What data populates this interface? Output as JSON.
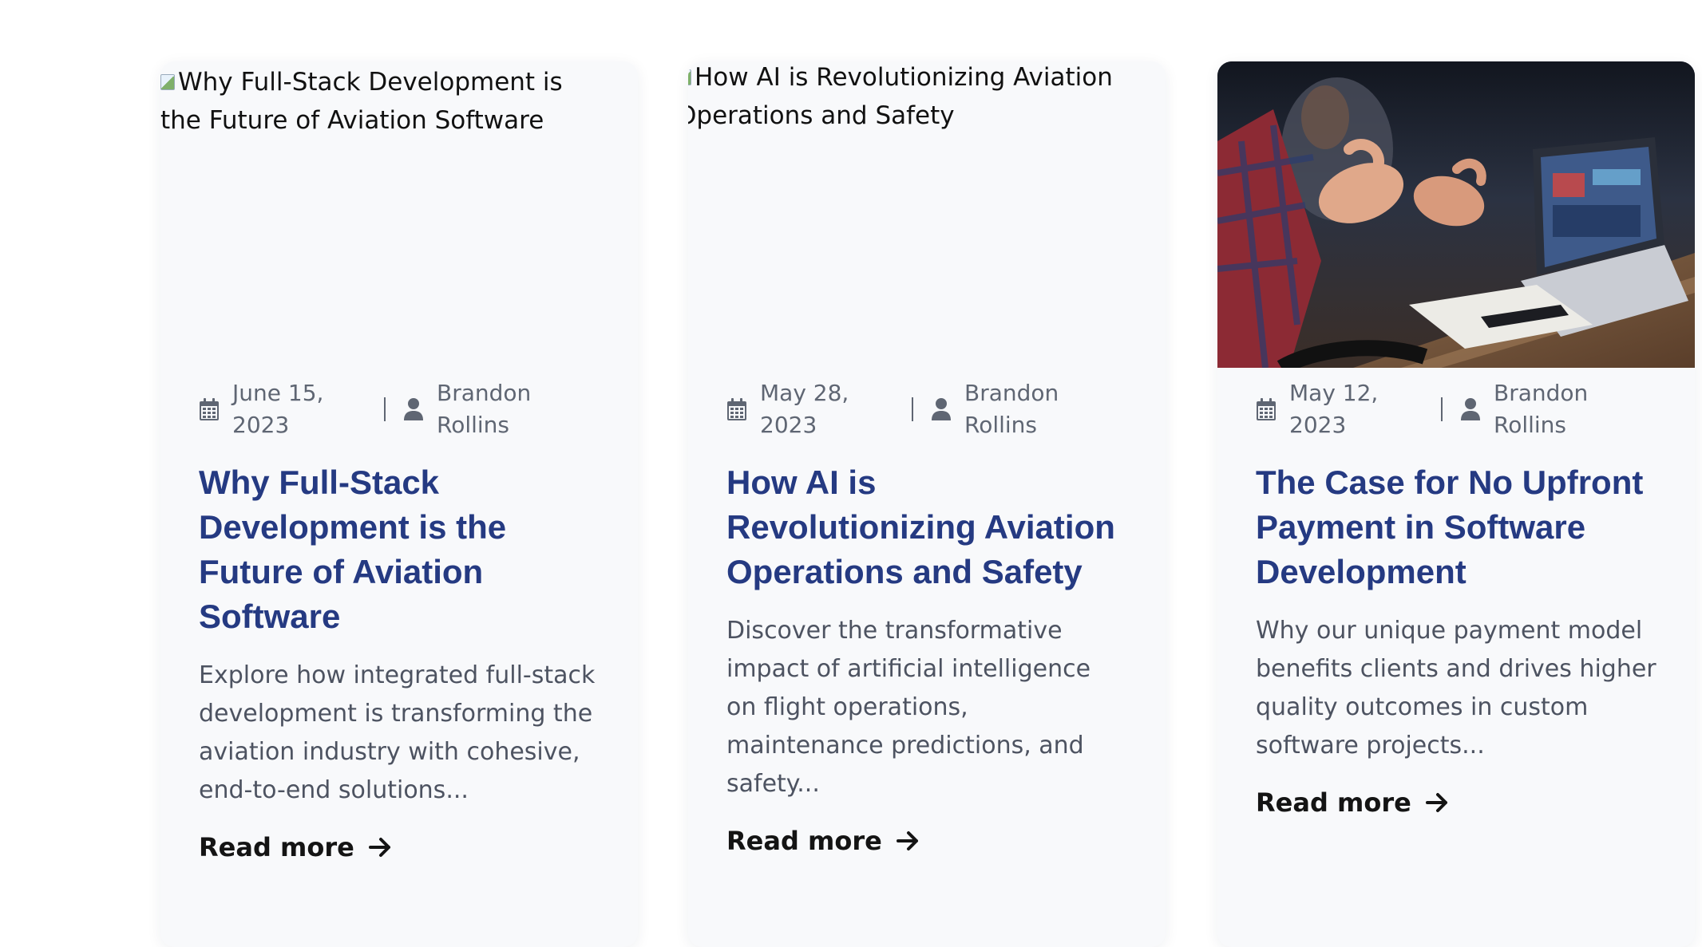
{
  "posts": [
    {
      "image_alt": "Why Full-Stack Development is the Future of Aviation Software",
      "date": "June 15, 2023",
      "author": "Brandon Rollins",
      "title": "Why Full-Stack Development is the Future of Aviation Software",
      "excerpt": "Explore how integrated full-stack development is transforming the aviation industry with cohesive, end-to-end solutions...",
      "read_more": "Read more"
    },
    {
      "image_alt": "How AI is Revolutionizing Aviation Operations and Safety",
      "date": "May 28, 2023",
      "author": "Brandon Rollins",
      "title": "How AI is Revolutionizing Aviation Operations and Safety",
      "excerpt": "Discover the transformative impact of artificial intelligence on flight operations, maintenance predictions, and safety...",
      "read_more": "Read more"
    },
    {
      "date": "May 12, 2023",
      "author": "Brandon Rollins",
      "title": "The Case for No Upfront Payment in Software Development",
      "excerpt": "Why our unique payment model benefits clients and drives higher quality outcomes in custom software projects...",
      "read_more": "Read more"
    }
  ],
  "icons": {
    "date": "calendar-icon",
    "author": "user-icon",
    "read_more": "arrow-right-icon"
  },
  "colors": {
    "title": "#253a82",
    "card_background": "#f8f9fb",
    "meta_text": "#5f6673",
    "excerpt_text": "#4d5361"
  }
}
